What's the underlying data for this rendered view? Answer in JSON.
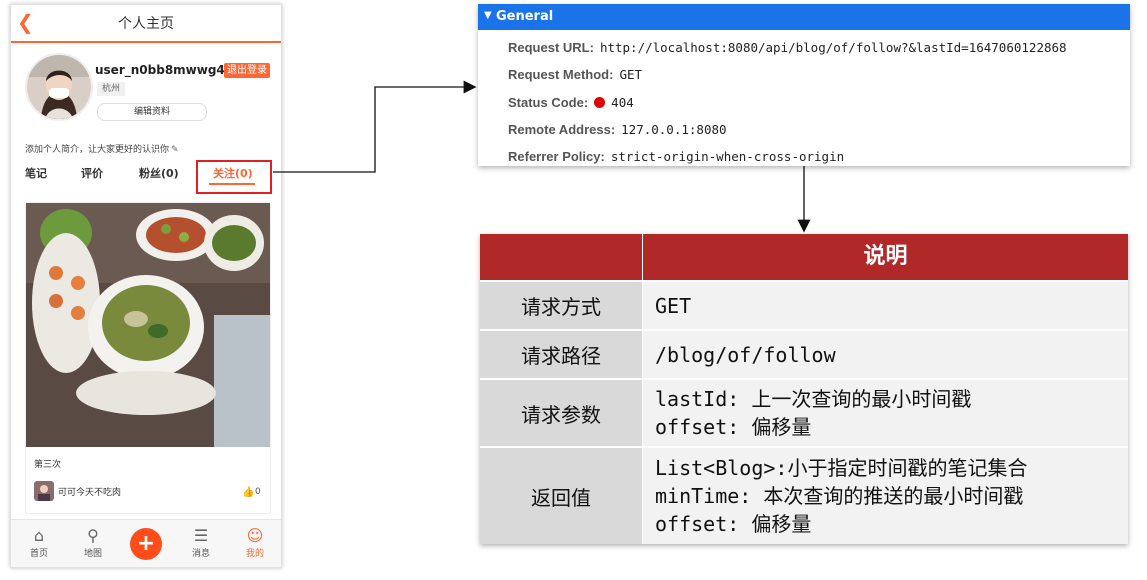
{
  "phone": {
    "title": "个人主页",
    "username": "user_n0bb8mwwg4",
    "logout": "退出登录",
    "city": "杭州",
    "edit_profile": "编辑资料",
    "bio": "添加个人简介，让大家更好的认识你",
    "tabs": {
      "notes": "笔记",
      "reviews": "评价",
      "fans": "粉丝(0)",
      "follow": "关注(0)"
    },
    "card": {
      "title": "第三次",
      "author": "可可今天不吃肉",
      "likes": "0"
    },
    "nav": {
      "home": "首页",
      "map": "地图",
      "messages": "消息",
      "mine": "我的"
    },
    "accent_color": "#ff6633"
  },
  "general": {
    "header": "General",
    "rows": [
      {
        "key": "Request URL:",
        "value": "http://localhost:8080/api/blog/of/follow?&lastId=1647060122868"
      },
      {
        "key": "Request Method:",
        "value": "GET"
      },
      {
        "key": "Status Code:",
        "value": "404"
      },
      {
        "key": "Remote Address:",
        "value": "127.0.0.1:8080"
      },
      {
        "key": "Referrer Policy:",
        "value": "strict-origin-when-cross-origin"
      }
    ],
    "header_color": "#1a73e8",
    "status_color": "#e00000"
  },
  "table": {
    "header": "说明",
    "header_color": "#b02828",
    "rows": [
      {
        "label": "请求方式",
        "lines": [
          "GET"
        ]
      },
      {
        "label": "请求路径",
        "lines": [
          "/blog/of/follow"
        ]
      },
      {
        "label": "请求参数",
        "lines": [
          "lastId: 上一次查询的最小时间戳",
          "offset: 偏移量"
        ]
      },
      {
        "label": "返回值",
        "lines": [
          "List<Blog>:小于指定时间戳的笔记集合",
          "minTime: 本次查询的推送的最小时间戳",
          "offset: 偏移量"
        ]
      }
    ]
  }
}
